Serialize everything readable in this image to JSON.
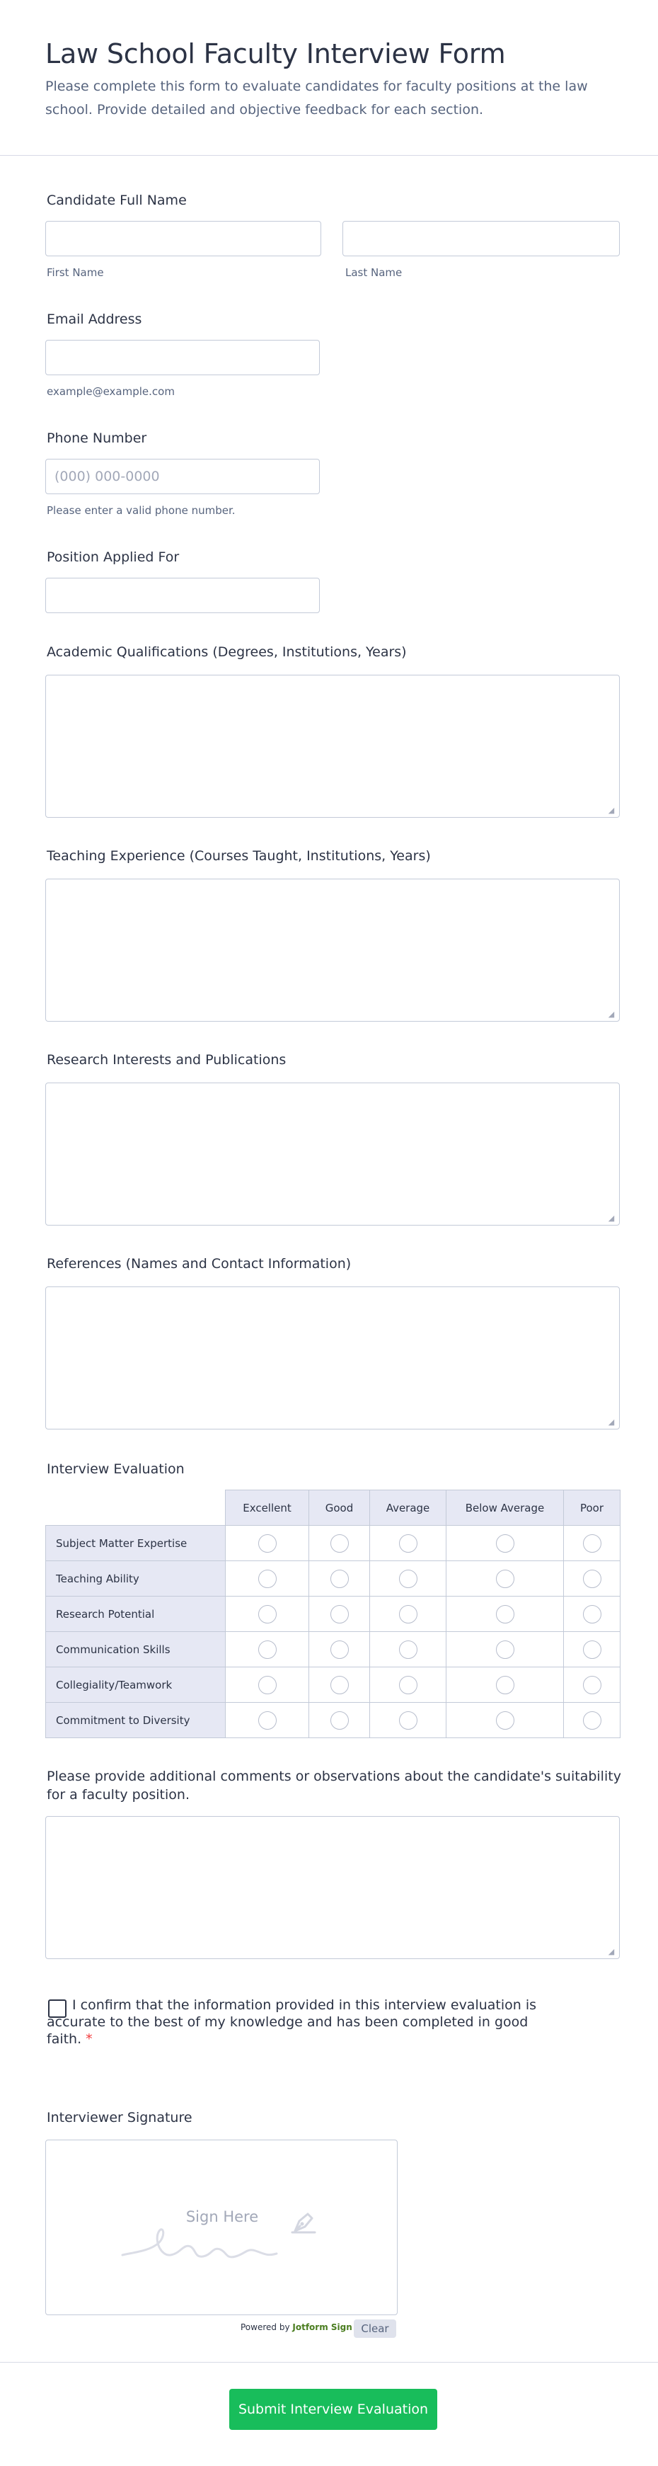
{
  "header": {
    "title": "Law School Faculty Interview Form",
    "subtitle": "Please complete this form to evaluate candidates for faculty positions at the law school. Provide detailed and objective feedback for each section."
  },
  "fields": {
    "name": {
      "label": "Candidate Full Name",
      "first_sublabel": "First Name",
      "last_sublabel": "Last Name"
    },
    "email": {
      "label": "Email Address",
      "sublabel": "example@example.com"
    },
    "phone": {
      "label": "Phone Number",
      "placeholder": "(000) 000-0000",
      "sublabel": "Please enter a valid phone number."
    },
    "position": {
      "label": "Position Applied For"
    },
    "academic": {
      "label": "Academic Qualifications (Degrees, Institutions, Years)"
    },
    "teaching": {
      "label": "Teaching Experience (Courses Taught, Institutions, Years)"
    },
    "research": {
      "label": "Research Interests and Publications"
    },
    "references": {
      "label": "References (Names and Contact Information)"
    },
    "comments": {
      "label": "Please provide additional comments or observations about the candidate's suitability for a faculty position."
    }
  },
  "evaluation": {
    "label": "Interview Evaluation",
    "columns": [
      "Excellent",
      "Good",
      "Average",
      "Below Average",
      "Poor"
    ],
    "rows": [
      "Subject Matter Expertise",
      "Teaching Ability",
      "Research Potential",
      "Communication Skills",
      "Collegiality/Teamwork",
      "Commitment to Diversity"
    ]
  },
  "confirm": {
    "text": "I confirm that the information provided in this interview evaluation is accurate to the best of my knowledge and has been completed in good faith.",
    "required_mark": "*"
  },
  "signature": {
    "label": "Interviewer Signature",
    "hint": "Sign Here",
    "powered_prefix": "Powered by",
    "powered_brand": "Jotform Sign",
    "clear_label": "Clear"
  },
  "submit": {
    "label": "Submit Interview Evaluation"
  },
  "colors": {
    "accent": "#18bd5b",
    "required": "#f23a3c",
    "matrix_header": "#e6e8f4"
  },
  "icons": {
    "resize": "resize-grip-icon",
    "signature_pen": "pen-nib-icon"
  }
}
